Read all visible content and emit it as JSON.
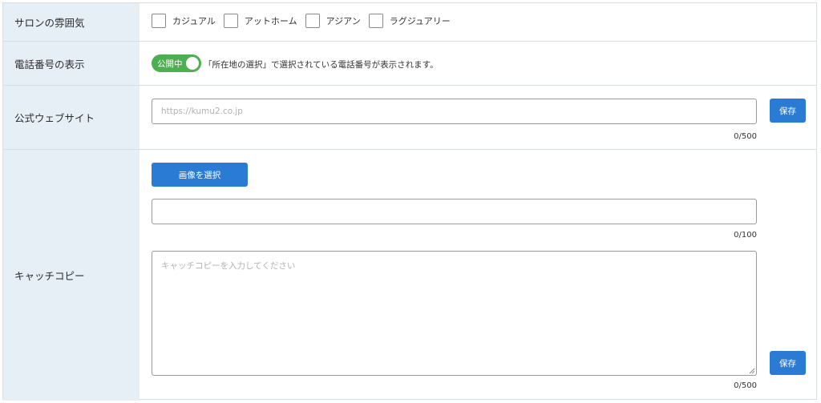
{
  "rows": {
    "atmosphere": {
      "label": "サロンの雰囲気",
      "options": [
        {
          "label": "カジュアル",
          "checked": false
        },
        {
          "label": "アットホーム",
          "checked": false
        },
        {
          "label": "アジアン",
          "checked": false
        },
        {
          "label": "ラグジュアリー",
          "checked": false
        }
      ]
    },
    "phone": {
      "label": "電話番号の表示",
      "toggle_label": "公開中",
      "toggle_on": true,
      "note": "「所在地の選択」で選択されている電話番号が表示されます。"
    },
    "website": {
      "label": "公式ウェブサイト",
      "placeholder": "https://kumu2.co.jp",
      "value": "",
      "save_label": "保存",
      "counter": "0/500"
    },
    "catchcopy": {
      "label": "キャッチコピー",
      "select_image_label": "画像を選択",
      "title_value": "",
      "title_counter": "0/100",
      "textarea_placeholder": "キャッチコピーを入力してください",
      "textarea_value": "",
      "save_label": "保存",
      "counter": "0/500"
    }
  },
  "colors": {
    "label_bg": "#e6eef6",
    "border": "#d6dde3",
    "primary": "#2a7bd4",
    "toggle_on": "#4caf50"
  }
}
